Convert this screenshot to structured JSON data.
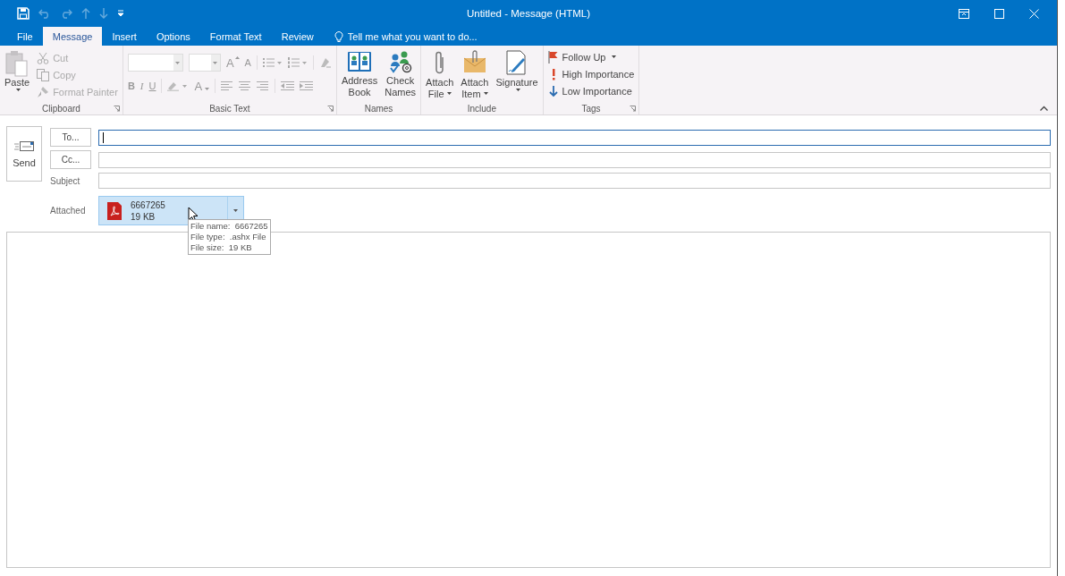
{
  "window": {
    "title": "Untitled - Message (HTML)"
  },
  "quick_access": [
    {
      "kind": "save",
      "disabled": false
    },
    {
      "kind": "undo",
      "disabled": true
    },
    {
      "kind": "redo",
      "disabled": true
    },
    {
      "kind": "up",
      "disabled": true
    },
    {
      "kind": "down",
      "disabled": true
    },
    {
      "kind": "customize",
      "disabled": false
    }
  ],
  "tabs": [
    {
      "label": "File",
      "selected": false
    },
    {
      "label": "Message",
      "selected": true
    },
    {
      "label": "Insert",
      "selected": false
    },
    {
      "label": "Options",
      "selected": false
    },
    {
      "label": "Format Text",
      "selected": false
    },
    {
      "label": "Review",
      "selected": false
    }
  ],
  "tell_me": "Tell me what you want to do...",
  "ribbon": {
    "clipboard": {
      "label": "Clipboard",
      "paste": {
        "label": "Paste",
        "caret": true
      },
      "items": [
        {
          "kind": "cut",
          "label": "Cut",
          "disabled": true
        },
        {
          "kind": "copy",
          "label": "Copy",
          "disabled": true
        },
        {
          "kind": "painter",
          "label": "Format Painter",
          "disabled": true
        }
      ]
    },
    "basic_text": {
      "label": "Basic Text",
      "disabled": true,
      "grow": "A",
      "shrink": "A",
      "bold": "B",
      "italic": "I",
      "underline": "U",
      "font_color": "A"
    },
    "names": {
      "label": "Names",
      "buttons": [
        {
          "kind": "book",
          "lines": [
            "Address",
            "Book"
          ],
          "caret": false
        },
        {
          "kind": "check",
          "lines": [
            "Check",
            "Names"
          ],
          "caret": false
        }
      ]
    },
    "include": {
      "label": "Include",
      "buttons": [
        {
          "kind": "clip",
          "lines": [
            "Attach",
            "File"
          ],
          "caret": true
        },
        {
          "kind": "envelope",
          "lines": [
            "Attach",
            "Item"
          ],
          "caret": true
        },
        {
          "kind": "signature",
          "lines": [
            "Signature"
          ],
          "caret": true
        }
      ]
    },
    "tags": {
      "label": "Tags",
      "items": [
        {
          "kind": "flag",
          "label": "Follow Up",
          "caret": true
        },
        {
          "kind": "high",
          "label": "High Importance",
          "caret": false
        },
        {
          "kind": "low",
          "label": "Low Importance",
          "caret": false
        }
      ]
    }
  },
  "compose": {
    "send": "Send",
    "to": "To...",
    "cc": "Cc...",
    "subject": "Subject",
    "attached_label": "Attached",
    "attachment": {
      "name": "6667265",
      "size": "19 KB"
    },
    "tooltip": [
      {
        "label": "File name:",
        "value": "6667265"
      },
      {
        "label": "File type:",
        "value": ".ashx File"
      },
      {
        "label": "File size:",
        "value": "19 KB"
      }
    ]
  }
}
